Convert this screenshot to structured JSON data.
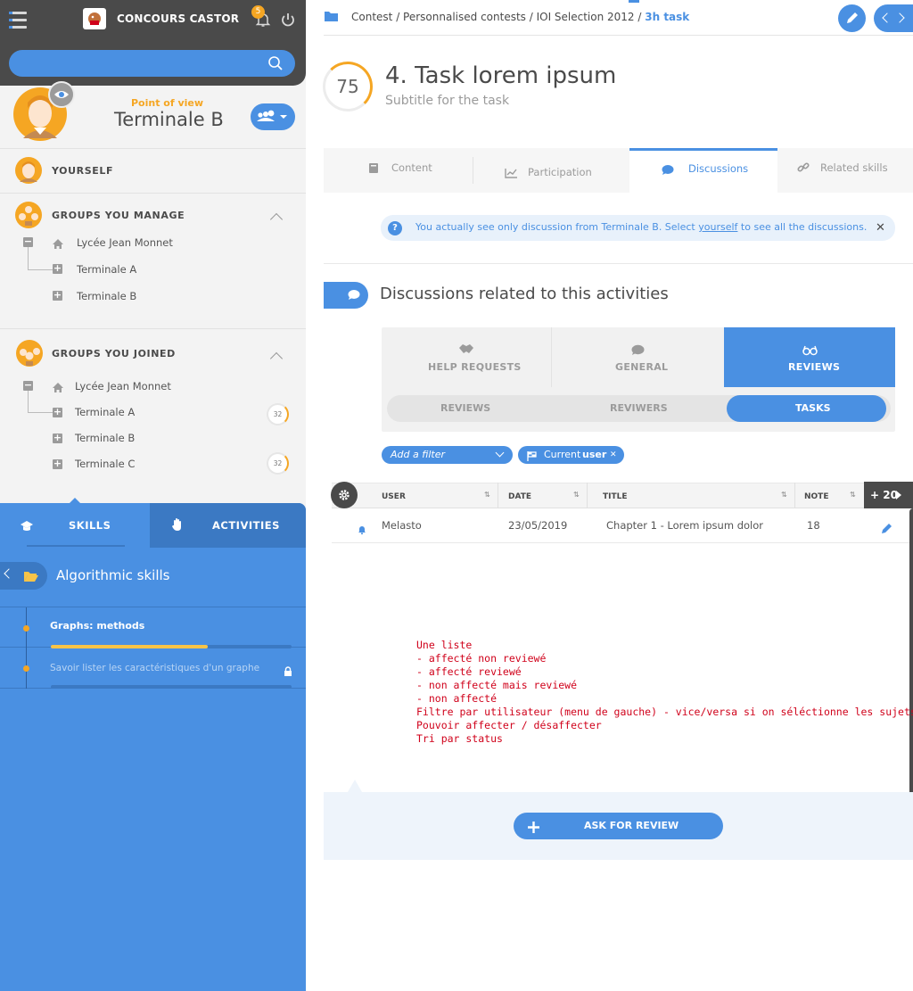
{
  "header": {
    "app_title": "CONCOURS CASTOR",
    "notification_count": "5",
    "search_placeholder": ""
  },
  "point_of_view": {
    "label": "Point of view",
    "group": "Terminale B"
  },
  "sidebar": {
    "yourself": "YOURSELF",
    "groups_manage": {
      "title": "GROUPS YOU MANAGE",
      "school": "Lycée Jean Monnet",
      "items": [
        "Terminale A",
        "Terminale B"
      ]
    },
    "groups_joined": {
      "title": "GROUPS YOU JOINED",
      "school": "Lycée Jean Monnet",
      "items": [
        {
          "label": "Terminale A",
          "badge": "32"
        },
        {
          "label": "Terminale B",
          "badge": ""
        },
        {
          "label": "Terminale C",
          "badge": "32"
        }
      ]
    }
  },
  "skills_panel": {
    "tab_skills": "SKILLS",
    "tab_activities": "ACTIVITIES",
    "category": "Algorithmic skills",
    "skills": [
      {
        "label": "Graphs: methods",
        "progress": 0.65,
        "locked": false
      },
      {
        "label": "Savoir lister les caractéristiques d'un graphe",
        "progress": 0,
        "locked": true
      }
    ]
  },
  "breadcrumb": {
    "parts": [
      "Contest",
      "Personnalised contests",
      "IOI Selection 2012"
    ],
    "separator": " / ",
    "current": "3h task"
  },
  "task": {
    "score": "75",
    "title": "4. Task lorem ipsum",
    "subtitle": "Subtitle for the task"
  },
  "tabs": [
    {
      "label": "Content",
      "icon": "book-icon"
    },
    {
      "label": "Participation",
      "icon": "chart-line-icon"
    },
    {
      "label": "Discussions",
      "icon": "comment-icon",
      "active": true
    },
    {
      "label": "Related skills",
      "icon": "link-icon"
    }
  ],
  "info": {
    "text_before": "You actually see only discussion from Terminale B. Select ",
    "link": "yourself",
    "text_after": " to see all the discussions."
  },
  "discussions": {
    "title": "Discussions related to this activities",
    "categories": [
      {
        "label": "HELP REQUESTS",
        "icon": "handshake-icon"
      },
      {
        "label": "GENERAL",
        "icon": "comment-icon"
      },
      {
        "label": "REVIEWS",
        "icon": "glasses-icon",
        "active": true
      }
    ],
    "segments": [
      "REVIEWS",
      "REVIWERS",
      "TASKS"
    ],
    "active_segment": "TASKS"
  },
  "filters": {
    "add_placeholder": "Add a filter",
    "current_prefix": "Current",
    "current_value": "user"
  },
  "table": {
    "columns": [
      "USER",
      "DATE",
      "TITLE",
      "NOTE"
    ],
    "more_label": "+ 20",
    "rows": [
      {
        "user": "Melasto",
        "date": "23/05/2019",
        "title": "Chapter 1 - Lorem ipsum dolor",
        "note": "18"
      }
    ]
  },
  "notes": "Une liste\n- affecté non reviewé\n- affecté reviewé\n- non affecté mais reviewé\n- non affecté\nFiltre par utilisateur (menu de gauche) - vice/versa si on séléctionne les sujets\nPouvoir affecter / désaffecter\nTri par status",
  "ask_review_label": "ASK FOR REVIEW",
  "colors": {
    "primary": "#4a90e2",
    "primary_dark": "#3b79c3",
    "accent": "#f5a623",
    "topbar": "#4a4a4a",
    "notes_red": "#d0021b"
  }
}
